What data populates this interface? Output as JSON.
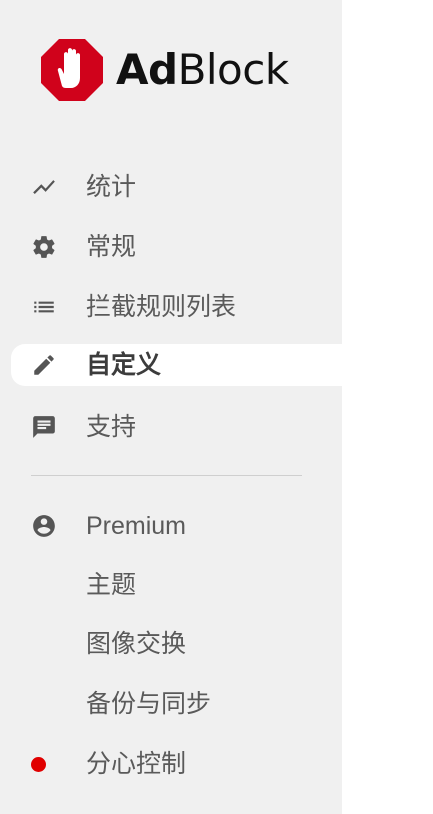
{
  "brand": {
    "name_part1": "Ad",
    "name_part2": "Block",
    "logo_color": "#d0021b"
  },
  "nav": {
    "stats": "统计",
    "general": "常规",
    "filter_lists": "拦截规则列表",
    "customize": "自定义",
    "support": "支持"
  },
  "premium": {
    "premium": "Premium",
    "themes": "主题",
    "image_swap": "图像交换",
    "backup_sync": "备份与同步",
    "distraction_control": "分心控制"
  },
  "colors": {
    "sidebar_bg": "#f0f0f0",
    "active_bg": "#ffffff",
    "dot_red": "#e00000"
  },
  "icons": {
    "stats": "trend-line-icon",
    "general": "gear-icon",
    "filter_lists": "list-icon",
    "customize": "pencil-icon",
    "support": "chat-icon",
    "premium": "account-circle-icon",
    "distraction_control": "red-dot-icon"
  }
}
